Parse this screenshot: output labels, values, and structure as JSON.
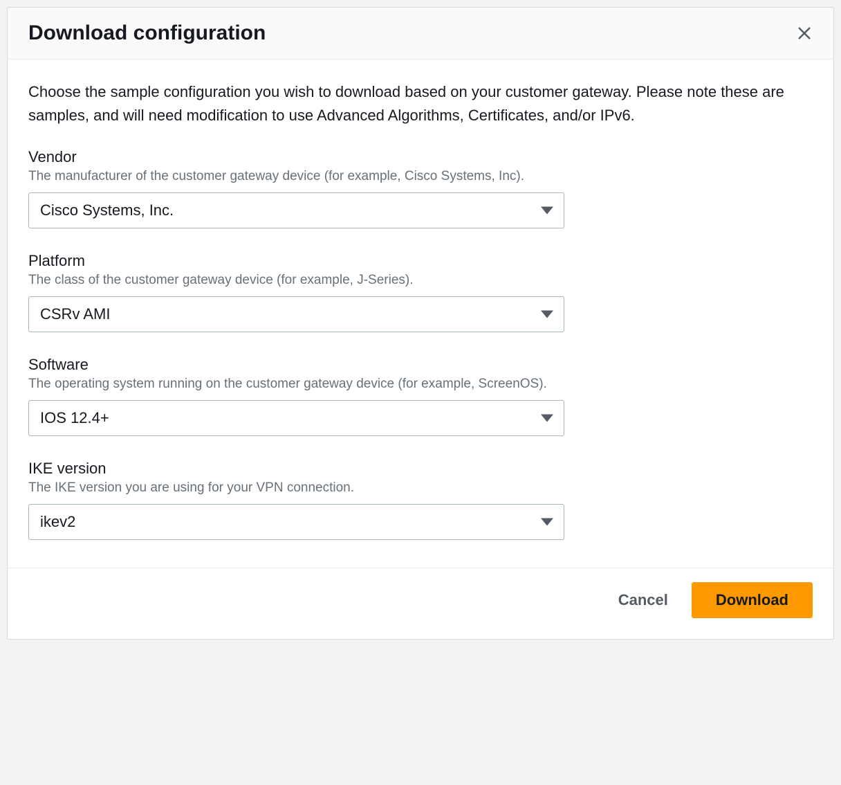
{
  "header": {
    "title": "Download configuration"
  },
  "body": {
    "description": "Choose the sample configuration you wish to download based on your customer gateway. Please note these are samples, and will need modification to use Advanced Algorithms, Certificates, and/or IPv6."
  },
  "form": {
    "vendor": {
      "label": "Vendor",
      "hint": "The manufacturer of the customer gateway device (for example, Cisco Systems, Inc).",
      "value": "Cisco Systems, Inc."
    },
    "platform": {
      "label": "Platform",
      "hint": "The class of the customer gateway device (for example, J-Series).",
      "value": "CSRv AMI"
    },
    "software": {
      "label": "Software",
      "hint": "The operating system running on the customer gateway device (for example, ScreenOS).",
      "value": "IOS 12.4+"
    },
    "ike": {
      "label": "IKE version",
      "hint": "The IKE version you are using for your VPN connection.",
      "value": "ikev2"
    }
  },
  "footer": {
    "cancel_label": "Cancel",
    "download_label": "Download"
  }
}
